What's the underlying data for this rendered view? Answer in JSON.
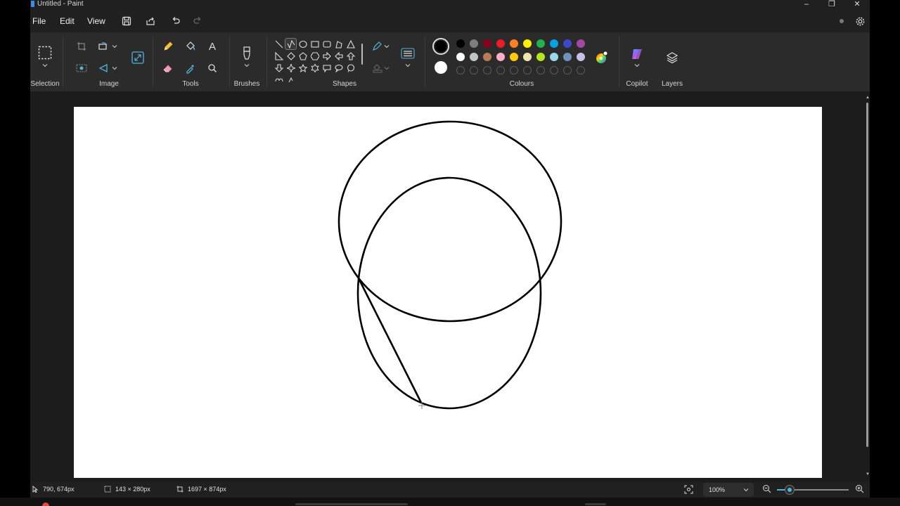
{
  "window": {
    "title": "Untitled - Paint",
    "min": "–",
    "max": "❐",
    "close": "✕"
  },
  "menu": {
    "file": "File",
    "edit": "Edit",
    "view": "View"
  },
  "ribbon": {
    "groups": {
      "selection": "Selection",
      "image": "Image",
      "tools": "Tools",
      "brushes": "Brushes",
      "shapes": "Shapes",
      "colours": "Colours",
      "copilot": "Copilot",
      "layers": "Layers"
    },
    "text_tool_glyph": "A",
    "colours": {
      "primary": "#000000",
      "secondary": "#ffffff",
      "row1": [
        "#000000",
        "#7f7f7f",
        "#88001b",
        "#ed1c24",
        "#ff7f27",
        "#fff200",
        "#22b14c",
        "#00a2e8",
        "#3f48cc",
        "#a349a4"
      ],
      "row2": [
        "#ffffff",
        "#c3c3c3",
        "#b97a57",
        "#ffaec9",
        "#ffc90e",
        "#efe4b0",
        "#b5e61d",
        "#99d9ea",
        "#7092be",
        "#c8bfe7"
      ]
    }
  },
  "status": {
    "cursor": "790, 674px",
    "selection": "143 × 280px",
    "canvas_size": "1697 × 874px",
    "zoom": "100%",
    "zoom_level": 0.18
  }
}
